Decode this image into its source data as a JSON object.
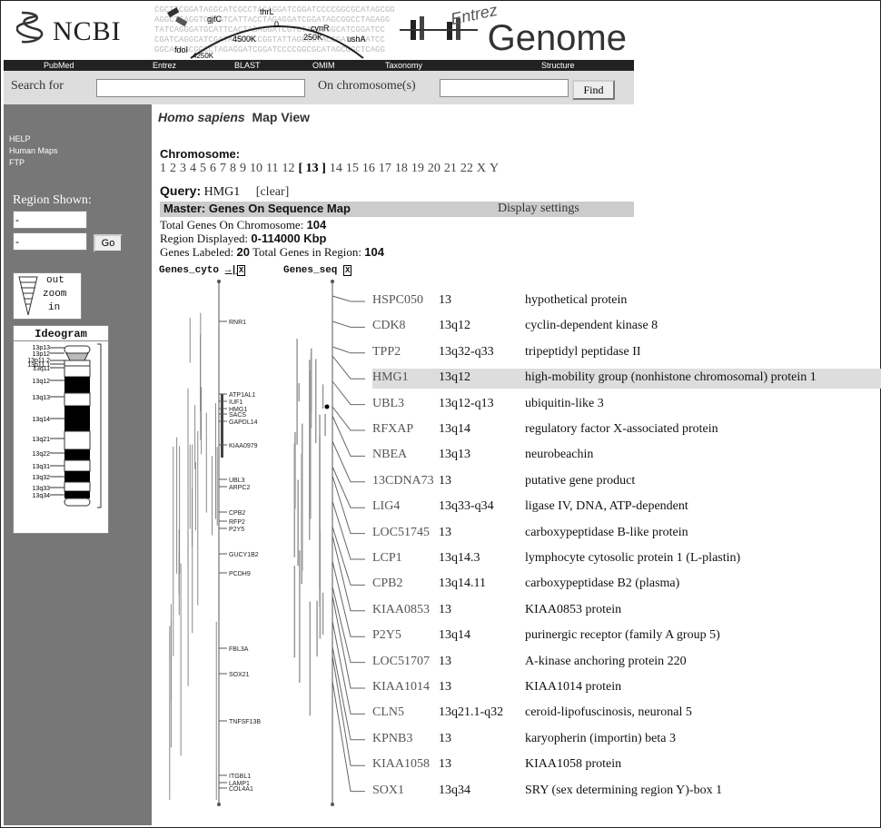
{
  "header": {
    "ncbi": "NCBI",
    "entrez_word": "Entrez",
    "genome_word": "Genome",
    "banner_labels": [
      "gjfC",
      "thrL",
      "cynR",
      "4500K",
      "0",
      "250K",
      "ushA",
      "fdoI",
      "4250K"
    ],
    "nav": [
      "PubMed",
      "Entrez",
      "BLAST",
      "OMIM",
      "Taxonomy",
      "Structure"
    ]
  },
  "search": {
    "label": "Search for",
    "chrom_label": "On chromosome(s)",
    "find": "Find",
    "value": "",
    "chrom_value": ""
  },
  "sidebar": {
    "links": [
      "HELP",
      "Human Maps",
      "FTP"
    ],
    "region_label": "Region Shown:",
    "from": "-",
    "to": "-",
    "go": "Go",
    "zoom": [
      "out",
      "zoom",
      "in"
    ],
    "ideogram_title": "Ideogram",
    "bands": [
      "13p13",
      "13p12",
      "13p11.2",
      "13p11.1",
      "13q11",
      "13q12",
      "13q13",
      "13q14",
      "13q21",
      "13q22",
      "13q31",
      "13q32",
      "13q33",
      "13q34"
    ]
  },
  "main": {
    "organism": "Homo sapiens",
    "view": "Map View",
    "chromosome_label": "Chromosome:",
    "chromosomes": [
      "1",
      "2",
      "3",
      "4",
      "5",
      "6",
      "7",
      "8",
      "9",
      "10",
      "11",
      "12",
      "[ 13 ]",
      "14",
      "15",
      "16",
      "17",
      "18",
      "19",
      "20",
      "21",
      "22",
      "X",
      "Y"
    ],
    "query_label": "Query:",
    "query": "HMG1",
    "clear": "[clear]",
    "master": "Master: Genes On Sequence Map",
    "display_settings": "Display settings",
    "total_label": "Total Genes On Chromosome:",
    "total": "104",
    "region_label": "Region Displayed:",
    "region": "0-114000 Kbp",
    "labeled_label": "Genes Labeled:",
    "labeled": "20",
    "in_region_label": "Total Genes in Region:",
    "in_region": "104",
    "map1": "Genes_cyto",
    "map2": "Genes_seq",
    "cyto_labels": [
      "RNR1",
      "ATP1AL1",
      "IUF1",
      "HMG1",
      "SACS",
      "GAPDL14",
      "KIAA0979",
      "UBL3",
      "ARPC2",
      "CPB2",
      "RFP2",
      "P2Y5",
      "GUCY1B2",
      "PCDH9",
      "FBL3A",
      "SOX21",
      "TNFSF13B",
      "ITGBL1",
      "LAMP1",
      "COL4A1"
    ]
  },
  "genes": [
    {
      "symbol": "HSPC050",
      "loc": "13",
      "desc": "hypothetical protein"
    },
    {
      "symbol": "CDK8",
      "loc": "13q12",
      "desc": "cyclin-dependent kinase 8"
    },
    {
      "symbol": "TPP2",
      "loc": "13q32-q33",
      "desc": "tripeptidyl peptidase II"
    },
    {
      "symbol": "HMG1",
      "loc": "13q12",
      "desc": "high-mobility group (nonhistone chromosomal) protein 1",
      "highlight": true
    },
    {
      "symbol": "UBL3",
      "loc": "13q12-q13",
      "desc": "ubiquitin-like 3"
    },
    {
      "symbol": "RFXAP",
      "loc": "13q14",
      "desc": "regulatory factor X-associated protein"
    },
    {
      "symbol": "NBEA",
      "loc": "13q13",
      "desc": "neurobeachin"
    },
    {
      "symbol": "13CDNA73",
      "loc": "13",
      "desc": "putative gene product"
    },
    {
      "symbol": "LIG4",
      "loc": "13q33-q34",
      "desc": "ligase IV, DNA, ATP-dependent"
    },
    {
      "symbol": "LOC51745",
      "loc": "13",
      "desc": "carboxypeptidase B-like protein"
    },
    {
      "symbol": "LCP1",
      "loc": "13q14.3",
      "desc": "lymphocyte cytosolic protein 1 (L-plastin)"
    },
    {
      "symbol": "CPB2",
      "loc": "13q14.11",
      "desc": "carboxypeptidase B2 (plasma)"
    },
    {
      "symbol": "KIAA0853",
      "loc": "13",
      "desc": "KIAA0853 protein"
    },
    {
      "symbol": "P2Y5",
      "loc": "13q14",
      "desc": "purinergic receptor (family A group 5)"
    },
    {
      "symbol": "LOC51707",
      "loc": "13",
      "desc": "A-kinase anchoring protein 220"
    },
    {
      "symbol": "KIAA1014",
      "loc": "13",
      "desc": "KIAA1014 protein"
    },
    {
      "symbol": "CLN5",
      "loc": "13q21.1-q32",
      "desc": "ceroid-lipofuscinosis, neuronal 5"
    },
    {
      "symbol": "KPNB3",
      "loc": "13",
      "desc": "karyopherin (importin) beta 3"
    },
    {
      "symbol": "KIAA1058",
      "loc": "13",
      "desc": "KIAA1058 protein"
    },
    {
      "symbol": "SOX1",
      "loc": "13q34",
      "desc": "SRY (sex determining region Y)-box 1"
    }
  ]
}
